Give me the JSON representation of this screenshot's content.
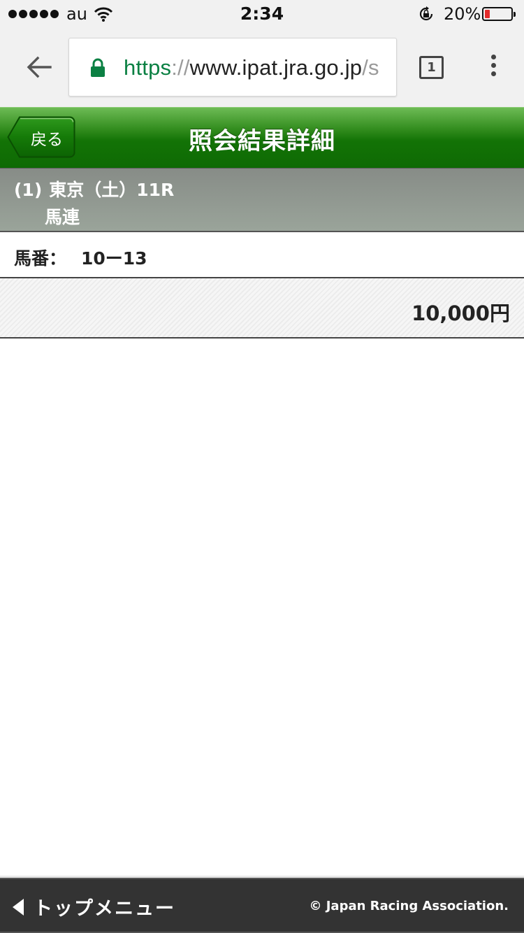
{
  "status_bar": {
    "carrier": "au",
    "time": "2:34",
    "battery_percent": "20%",
    "battery_level": 0.2,
    "battery_color": "#e42b2b"
  },
  "browser": {
    "url_scheme": "https",
    "url_separator": "://",
    "url_host": "www.ipat.jra.go.jp",
    "url_rest": "/s",
    "tab_count": "1",
    "scheme_color": "#0b8043"
  },
  "header": {
    "back_label": "戻る",
    "title": "照会結果詳細",
    "brand_color": "#137306"
  },
  "race": {
    "number": "(1)",
    "description": "東京（土）11R",
    "bet_type": "馬連"
  },
  "bet": {
    "horse_label": "馬番：",
    "horse_numbers": "10ー13",
    "amount": "10,000円"
  },
  "footer": {
    "top_menu_label": "トップメニュー",
    "copyright": "© Japan Racing Association."
  },
  "icons": {
    "signal": "signal-dots-icon",
    "wifi": "wifi-icon",
    "rotation_lock": "rotation-lock-icon",
    "battery": "battery-icon",
    "back": "back-arrow-icon",
    "padlock": "padlock-icon",
    "tabs": "tab-switcher-icon",
    "menu": "more-vert-icon",
    "footer_arrow": "triangle-left-icon"
  }
}
